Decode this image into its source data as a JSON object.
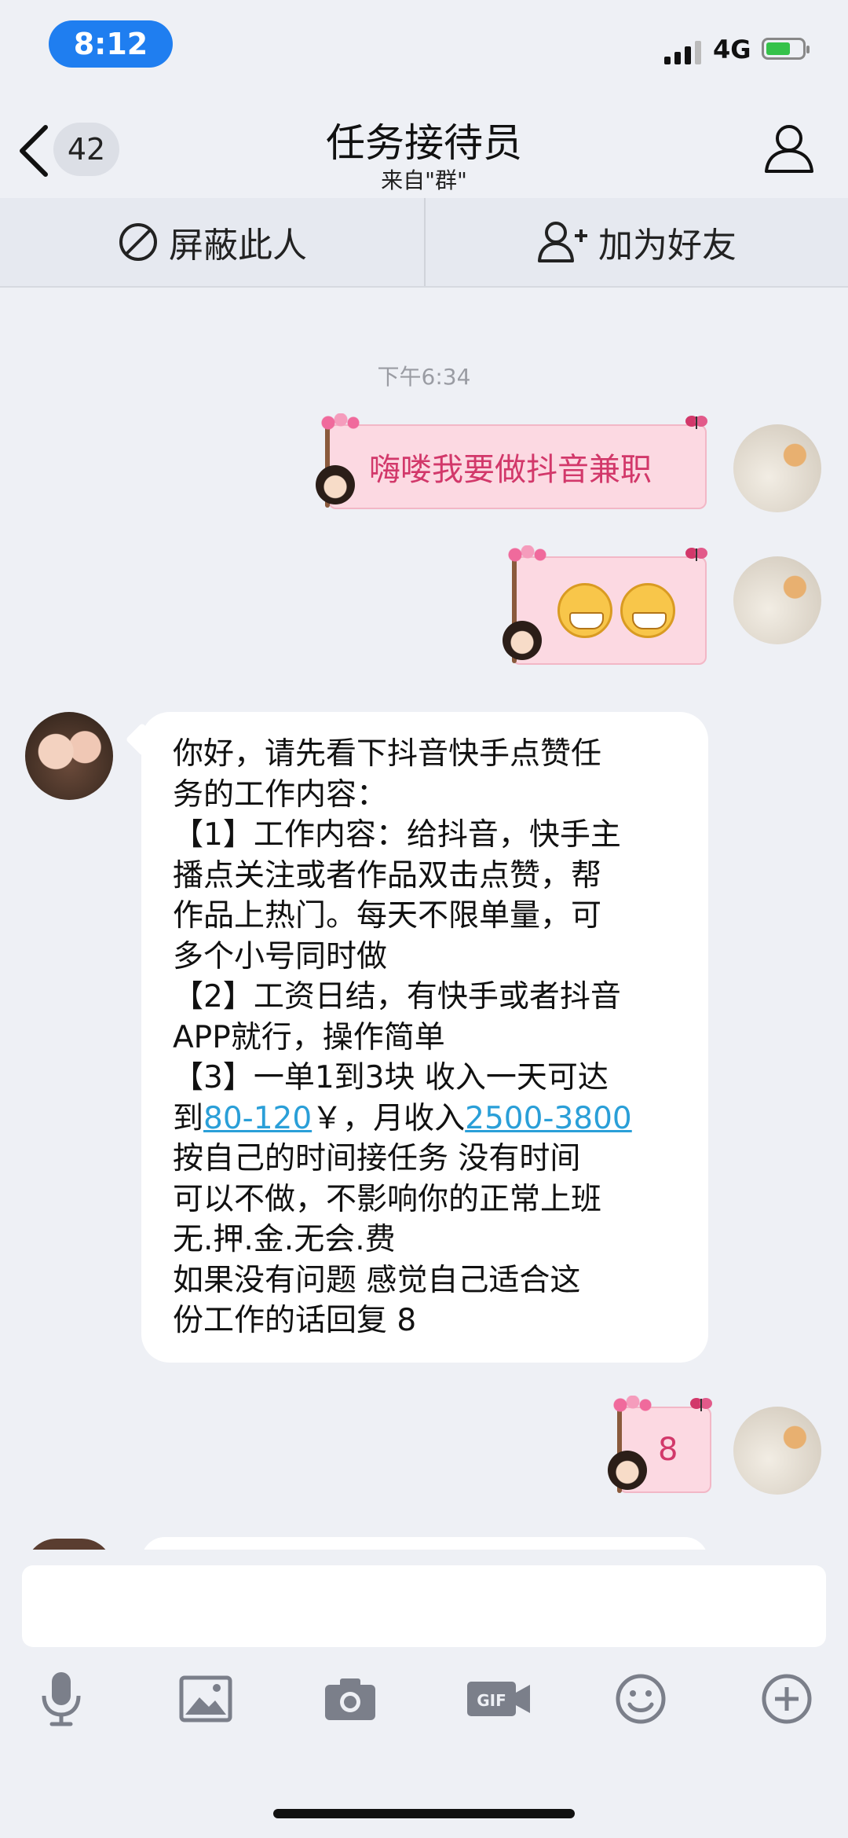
{
  "status_bar": {
    "time": "8:12",
    "network": "4G"
  },
  "nav": {
    "unread_count": "42",
    "title": "任务接待员",
    "subtitle": "来自\"群\""
  },
  "actions": {
    "block_label": "屏蔽此人",
    "add_friend_label": "加为好友"
  },
  "chat": {
    "timestamp": "下午6:34",
    "messages": [
      {
        "from": "me",
        "text": "嗨喽我要做抖音兼职"
      },
      {
        "from": "me",
        "emoji": "grinning-face-emoji x2"
      },
      {
        "from": "other",
        "lines": [
          "你好，请先看下抖音快手点赞任",
          "务的工作内容：",
          "【1】工作内容：给抖音，快手主",
          "播点关注或者作品双击点赞，帮",
          "作品上热门。每天不限单量，可",
          "多个小号同时做",
          "【2】工资日结，有快手或者抖音",
          "APP就行，操作简单",
          "【3】一单1到3块  收入一天可达",
          "到",
          "80-120",
          "￥，月收入",
          "2500-3800",
          "  按自己的时间接任务 没有时间",
          "可以不做，不影响你的正常上班",
          "无.押.金.无会.费",
          "  如果没有问题 感觉自己适合这",
          "份工作的话回复  8"
        ]
      },
      {
        "from": "me",
        "text": "8"
      }
    ]
  },
  "toolbar": {
    "icons": [
      "microphone-icon",
      "image-icon",
      "camera-icon",
      "gif-icon",
      "emoji-icon",
      "plus-icon"
    ]
  },
  "colors": {
    "accent": "#1f7ef0",
    "link": "#2a9fd8",
    "sticker_text": "#d2386a"
  }
}
